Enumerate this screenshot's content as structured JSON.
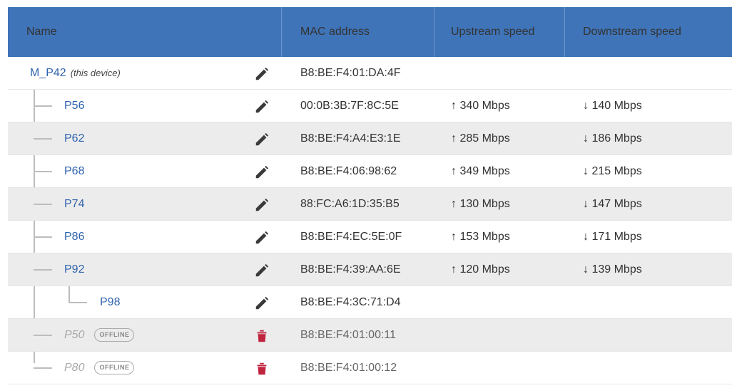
{
  "colors": {
    "header_bg": "#3f74b8",
    "link": "#2f63ad",
    "delete": "#c0243f"
  },
  "header": {
    "name": "Name",
    "mac": "MAC address",
    "upstream": "Upstream speed",
    "downstream": "Downstream speed"
  },
  "rows": [
    {
      "name": "M_P42",
      "note": "(this device)",
      "mac": "B8:BE:F4:01:DA:4F",
      "up": "",
      "down": "",
      "icon": "pencil-icon"
    },
    {
      "name": "P56",
      "mac": "00:0B:3B:7F:8C:5E",
      "up": "↑ 340 Mbps",
      "down": "↓ 140 Mbps",
      "icon": "pencil-icon"
    },
    {
      "name": "P62",
      "mac": "B8:BE:F4:A4:E3:1E",
      "up": "↑ 285 Mbps",
      "down": "↓ 186 Mbps",
      "icon": "pencil-icon"
    },
    {
      "name": "P68",
      "mac": "B8:BE:F4:06:98:62",
      "up": "↑ 349 Mbps",
      "down": "↓ 215 Mbps",
      "icon": "pencil-icon"
    },
    {
      "name": "P74",
      "mac": "88:FC:A6:1D:35:B5",
      "up": "↑ 130 Mbps",
      "down": "↓ 147 Mbps",
      "icon": "pencil-icon"
    },
    {
      "name": "P86",
      "mac": "B8:BE:F4:EC:5E:0F",
      "up": "↑ 153 Mbps",
      "down": "↓ 171 Mbps",
      "icon": "pencil-icon"
    },
    {
      "name": "P92",
      "mac": "B8:BE:F4:39:AA:6E",
      "up": "↑ 120 Mbps",
      "down": "↓ 139 Mbps",
      "icon": "pencil-icon"
    },
    {
      "name": "P98",
      "mac": "B8:BE:F4:3C:71:D4",
      "up": "",
      "down": "",
      "icon": "pencil-icon"
    },
    {
      "name": "P50",
      "badge": "OFFLINE",
      "mac": "B8:BE:F4:01:00:11",
      "up": "",
      "down": "",
      "icon": "trash-icon"
    },
    {
      "name": "P80",
      "badge": "OFFLINE",
      "mac": "B8:BE:F4:01:00:12",
      "up": "",
      "down": "",
      "icon": "trash-icon"
    }
  ]
}
